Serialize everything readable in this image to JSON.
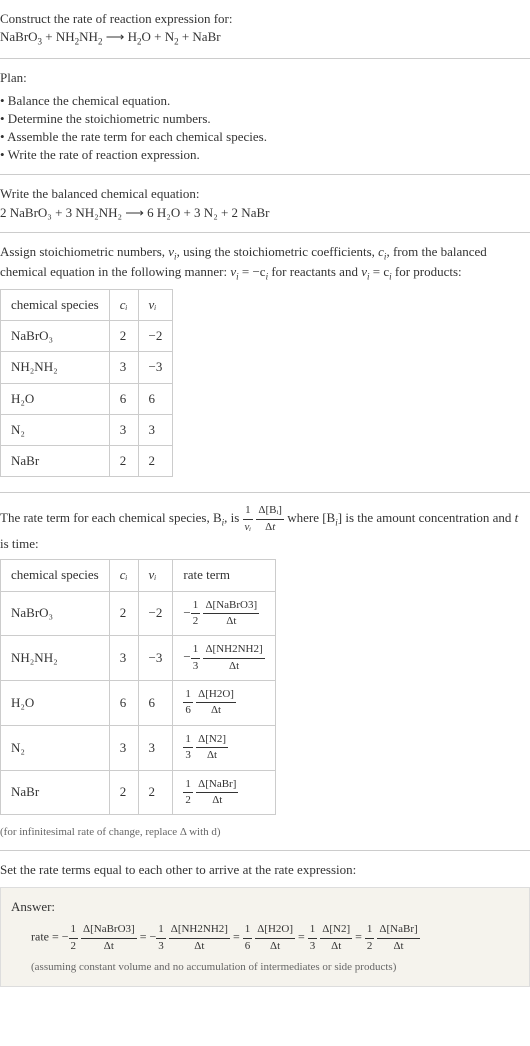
{
  "intro": {
    "prompt": "Construct the rate of reaction expression for:",
    "equation_lhs": "NaBrO",
    "equation_lhs2": " + NH",
    "equation_lhs3": "NH",
    "arrow": " ⟶ ",
    "equation_rhs1": "H",
    "equation_rhs2": "O + N",
    "equation_rhs3": " + NaBr"
  },
  "plan": {
    "title": "Plan:",
    "items": [
      "• Balance the chemical equation.",
      "• Determine the stoichiometric numbers.",
      "• Assemble the rate term for each chemical species.",
      "• Write the rate of reaction expression."
    ]
  },
  "balanced": {
    "title": "Write the balanced chemical equation:",
    "text": "2 NaBrO₃ + 3 NH₂NH₂ ⟶ 6 H₂O + 3 N₂ + 2 NaBr"
  },
  "stoich": {
    "text1": "Assign stoichiometric numbers, ",
    "var_nu": "ν",
    "var_i": "i",
    "text2": ", using the stoichiometric coefficients, ",
    "var_c": "c",
    "text3": ", from the balanced chemical equation in the following manner: ",
    "rel1": "ν",
    "rel2": " = −c",
    "text4": " for reactants and ",
    "rel3": " = c",
    "text5": " for products:",
    "table": {
      "headers": [
        "chemical species",
        "cᵢ",
        "νᵢ"
      ],
      "rows": [
        [
          "NaBrO₃",
          "2",
          "−2"
        ],
        [
          "NH₂NH₂",
          "3",
          "−3"
        ],
        [
          "H₂O",
          "6",
          "6"
        ],
        [
          "N₂",
          "3",
          "3"
        ],
        [
          "NaBr",
          "2",
          "2"
        ]
      ]
    }
  },
  "rateterm": {
    "text1": "The rate term for each chemical species, B",
    "text2": ", is ",
    "text3": " where [B",
    "text4": "] is the amount concentration and ",
    "var_t": "t",
    "text5": " is time:",
    "table": {
      "headers": [
        "chemical species",
        "cᵢ",
        "νᵢ",
        "rate term"
      ],
      "rows": [
        {
          "species": "NaBrO₃",
          "c": "2",
          "nu": "−2",
          "sign": "−",
          "coef_num": "1",
          "coef_den": "2",
          "delta_sp": "Δ[NaBrO3]"
        },
        {
          "species": "NH₂NH₂",
          "c": "3",
          "nu": "−3",
          "sign": "−",
          "coef_num": "1",
          "coef_den": "3",
          "delta_sp": "Δ[NH2NH2]"
        },
        {
          "species": "H₂O",
          "c": "6",
          "nu": "6",
          "sign": "",
          "coef_num": "1",
          "coef_den": "6",
          "delta_sp": "Δ[H2O]"
        },
        {
          "species": "N₂",
          "c": "3",
          "nu": "3",
          "sign": "",
          "coef_num": "1",
          "coef_den": "3",
          "delta_sp": "Δ[N2]"
        },
        {
          "species": "NaBr",
          "c": "2",
          "nu": "2",
          "sign": "",
          "coef_num": "1",
          "coef_den": "2",
          "delta_sp": "Δ[NaBr]"
        }
      ]
    },
    "footnote": "(for infinitesimal rate of change, replace Δ with d)"
  },
  "final": {
    "title": "Set the rate terms equal to each other to arrive at the rate expression:",
    "answer_label": "Answer:",
    "rate_eq": "rate = ",
    "terms": [
      {
        "sign": "−",
        "num": "1",
        "den": "2",
        "sp": "Δ[NaBrO3]"
      },
      {
        "sign": "= −",
        "num": "1",
        "den": "3",
        "sp": "Δ[NH2NH2]"
      },
      {
        "sign": "= ",
        "num": "1",
        "den": "6",
        "sp": "Δ[H2O]"
      },
      {
        "sign": "= ",
        "num": "1",
        "den": "3",
        "sp": "Δ[N2]"
      },
      {
        "sign": "= ",
        "num": "1",
        "den": "2",
        "sp": "Δ[NaBr]"
      }
    ],
    "note": "(assuming constant volume and no accumulation of intermediates or side products)",
    "dt": "Δt"
  },
  "frac_main": {
    "one": "1",
    "nu_i": "νᵢ",
    "dBi": "Δ[Bᵢ]",
    "dt": "Δt"
  }
}
